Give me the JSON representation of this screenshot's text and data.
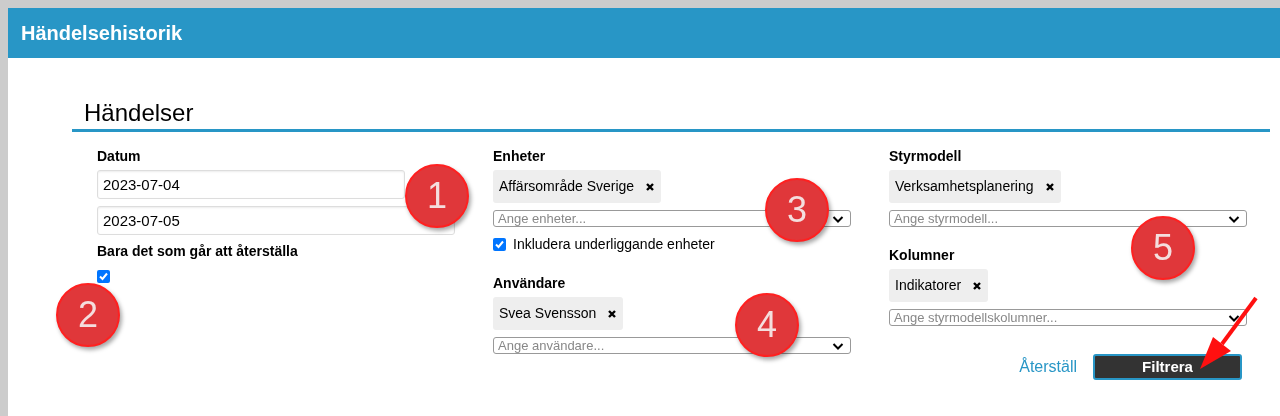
{
  "window": {
    "title": "Händelsehistorik"
  },
  "section": {
    "title": "Händelser"
  },
  "columns": [
    {
      "fields": [
        {
          "kind": "dates",
          "label": "Datum",
          "values": [
            "2023-07-04",
            "2023-07-05"
          ]
        },
        {
          "kind": "checkbox",
          "label": "Bara det som går att återställa",
          "checked": true
        }
      ]
    },
    {
      "fields": [
        {
          "kind": "multiselect",
          "label": "Enheter",
          "chips": [
            "Affärsområde Sverige"
          ],
          "placeholder": "Ange enheter...",
          "option": {
            "label": "Inkludera underliggande enheter",
            "checked": true
          }
        },
        {
          "kind": "multiselect",
          "label": "Användare",
          "chips": [
            "Svea Svensson"
          ],
          "placeholder": "Ange användare..."
        }
      ]
    },
    {
      "fields": [
        {
          "kind": "multiselect",
          "label": "Styrmodell",
          "chips": [
            "Verksamhetsplanering"
          ],
          "placeholder": "Ange styrmodell..."
        },
        {
          "kind": "multiselect",
          "label": "Kolumner",
          "chips": [
            "Indikatorer"
          ],
          "placeholder": "Ange styrmodellskolumner..."
        }
      ]
    }
  ],
  "actions": [
    {
      "kind": "link",
      "label": "Återställ"
    },
    {
      "kind": "button",
      "label": "Filtrera"
    }
  ],
  "annotations": [
    {
      "label": "1"
    },
    {
      "label": "2"
    },
    {
      "label": "3"
    },
    {
      "label": "4"
    },
    {
      "label": "5"
    }
  ]
}
